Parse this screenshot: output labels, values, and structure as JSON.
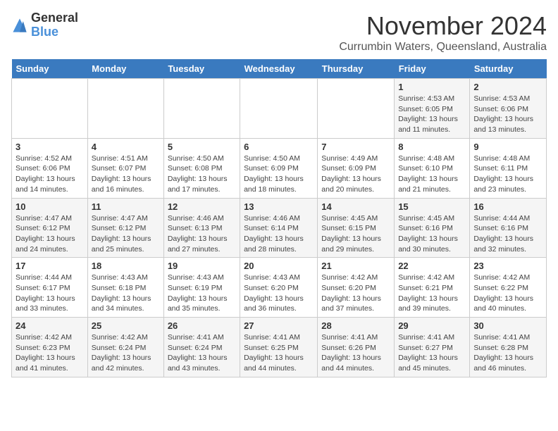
{
  "logo": {
    "general": "General",
    "blue": "Blue"
  },
  "title": "November 2024",
  "location": "Currumbin Waters, Queensland, Australia",
  "days_header": [
    "Sunday",
    "Monday",
    "Tuesday",
    "Wednesday",
    "Thursday",
    "Friday",
    "Saturday"
  ],
  "weeks": [
    [
      {
        "day": "",
        "info": ""
      },
      {
        "day": "",
        "info": ""
      },
      {
        "day": "",
        "info": ""
      },
      {
        "day": "",
        "info": ""
      },
      {
        "day": "",
        "info": ""
      },
      {
        "day": "1",
        "info": "Sunrise: 4:53 AM\nSunset: 6:05 PM\nDaylight: 13 hours and 11 minutes."
      },
      {
        "day": "2",
        "info": "Sunrise: 4:53 AM\nSunset: 6:06 PM\nDaylight: 13 hours and 13 minutes."
      }
    ],
    [
      {
        "day": "3",
        "info": "Sunrise: 4:52 AM\nSunset: 6:06 PM\nDaylight: 13 hours and 14 minutes."
      },
      {
        "day": "4",
        "info": "Sunrise: 4:51 AM\nSunset: 6:07 PM\nDaylight: 13 hours and 16 minutes."
      },
      {
        "day": "5",
        "info": "Sunrise: 4:50 AM\nSunset: 6:08 PM\nDaylight: 13 hours and 17 minutes."
      },
      {
        "day": "6",
        "info": "Sunrise: 4:50 AM\nSunset: 6:09 PM\nDaylight: 13 hours and 18 minutes."
      },
      {
        "day": "7",
        "info": "Sunrise: 4:49 AM\nSunset: 6:09 PM\nDaylight: 13 hours and 20 minutes."
      },
      {
        "day": "8",
        "info": "Sunrise: 4:48 AM\nSunset: 6:10 PM\nDaylight: 13 hours and 21 minutes."
      },
      {
        "day": "9",
        "info": "Sunrise: 4:48 AM\nSunset: 6:11 PM\nDaylight: 13 hours and 23 minutes."
      }
    ],
    [
      {
        "day": "10",
        "info": "Sunrise: 4:47 AM\nSunset: 6:12 PM\nDaylight: 13 hours and 24 minutes."
      },
      {
        "day": "11",
        "info": "Sunrise: 4:47 AM\nSunset: 6:12 PM\nDaylight: 13 hours and 25 minutes."
      },
      {
        "day": "12",
        "info": "Sunrise: 4:46 AM\nSunset: 6:13 PM\nDaylight: 13 hours and 27 minutes."
      },
      {
        "day": "13",
        "info": "Sunrise: 4:46 AM\nSunset: 6:14 PM\nDaylight: 13 hours and 28 minutes."
      },
      {
        "day": "14",
        "info": "Sunrise: 4:45 AM\nSunset: 6:15 PM\nDaylight: 13 hours and 29 minutes."
      },
      {
        "day": "15",
        "info": "Sunrise: 4:45 AM\nSunset: 6:16 PM\nDaylight: 13 hours and 30 minutes."
      },
      {
        "day": "16",
        "info": "Sunrise: 4:44 AM\nSunset: 6:16 PM\nDaylight: 13 hours and 32 minutes."
      }
    ],
    [
      {
        "day": "17",
        "info": "Sunrise: 4:44 AM\nSunset: 6:17 PM\nDaylight: 13 hours and 33 minutes."
      },
      {
        "day": "18",
        "info": "Sunrise: 4:43 AM\nSunset: 6:18 PM\nDaylight: 13 hours and 34 minutes."
      },
      {
        "day": "19",
        "info": "Sunrise: 4:43 AM\nSunset: 6:19 PM\nDaylight: 13 hours and 35 minutes."
      },
      {
        "day": "20",
        "info": "Sunrise: 4:43 AM\nSunset: 6:20 PM\nDaylight: 13 hours and 36 minutes."
      },
      {
        "day": "21",
        "info": "Sunrise: 4:42 AM\nSunset: 6:20 PM\nDaylight: 13 hours and 37 minutes."
      },
      {
        "day": "22",
        "info": "Sunrise: 4:42 AM\nSunset: 6:21 PM\nDaylight: 13 hours and 39 minutes."
      },
      {
        "day": "23",
        "info": "Sunrise: 4:42 AM\nSunset: 6:22 PM\nDaylight: 13 hours and 40 minutes."
      }
    ],
    [
      {
        "day": "24",
        "info": "Sunrise: 4:42 AM\nSunset: 6:23 PM\nDaylight: 13 hours and 41 minutes."
      },
      {
        "day": "25",
        "info": "Sunrise: 4:42 AM\nSunset: 6:24 PM\nDaylight: 13 hours and 42 minutes."
      },
      {
        "day": "26",
        "info": "Sunrise: 4:41 AM\nSunset: 6:24 PM\nDaylight: 13 hours and 43 minutes."
      },
      {
        "day": "27",
        "info": "Sunrise: 4:41 AM\nSunset: 6:25 PM\nDaylight: 13 hours and 44 minutes."
      },
      {
        "day": "28",
        "info": "Sunrise: 4:41 AM\nSunset: 6:26 PM\nDaylight: 13 hours and 44 minutes."
      },
      {
        "day": "29",
        "info": "Sunrise: 4:41 AM\nSunset: 6:27 PM\nDaylight: 13 hours and 45 minutes."
      },
      {
        "day": "30",
        "info": "Sunrise: 4:41 AM\nSunset: 6:28 PM\nDaylight: 13 hours and 46 minutes."
      }
    ]
  ]
}
